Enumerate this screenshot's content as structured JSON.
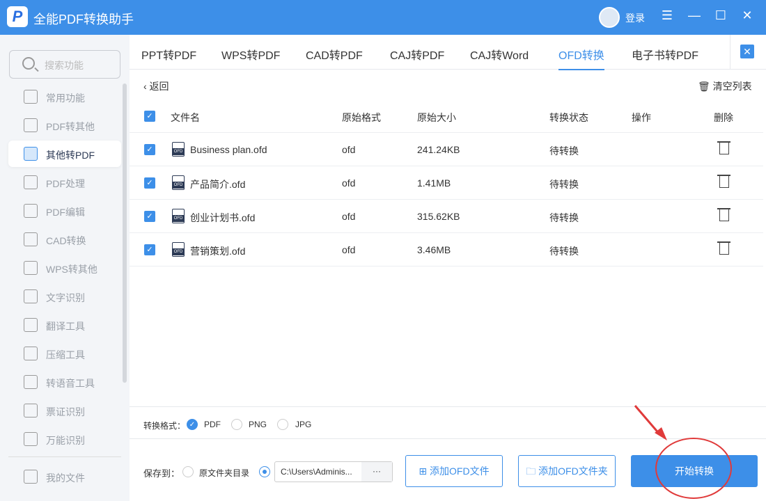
{
  "app": {
    "logo_letter": "P",
    "title": "全能PDF转换助手",
    "login": "登录",
    "menu": "☰",
    "minimize": "—",
    "maximize": "☐",
    "close": "✕"
  },
  "sidebar": {
    "search_placeholder": "搜索功能",
    "items": [
      {
        "label": "常用功能"
      },
      {
        "label": "PDF转其他"
      },
      {
        "label": "其他转PDF",
        "active": true
      },
      {
        "label": "PDF处理"
      },
      {
        "label": "PDF编辑"
      },
      {
        "label": "CAD转换"
      },
      {
        "label": "WPS转其他"
      },
      {
        "label": "文字识别"
      },
      {
        "label": "翻译工具"
      },
      {
        "label": "压缩工具"
      },
      {
        "label": "转语音工具"
      },
      {
        "label": "票证识别"
      },
      {
        "label": "万能识别"
      }
    ],
    "my_files": "我的文件"
  },
  "tabs": [
    {
      "label": "PPT转PDF"
    },
    {
      "label": "WPS转PDF"
    },
    {
      "label": "CAD转PDF"
    },
    {
      "label": "CAJ转PDF"
    },
    {
      "label": "CAJ转Word"
    },
    {
      "label": "OFD转换",
      "active": true
    },
    {
      "label": "电子书转PDF"
    }
  ],
  "tab_close": "✕",
  "toolbar": {
    "back": "‹  返回",
    "clear": "清空列表"
  },
  "table": {
    "columns": [
      "文件名",
      "原始格式",
      "原始大小",
      "转换状态",
      "操作",
      "删除"
    ],
    "rows": [
      {
        "name": "Business plan.ofd",
        "format": "ofd",
        "size": "241.24KB",
        "status": "待转换"
      },
      {
        "name": "产品简介.ofd",
        "format": "ofd",
        "size": "1.41MB",
        "status": "待转换"
      },
      {
        "name": "创业计划书.ofd",
        "format": "ofd",
        "size": "315.62KB",
        "status": "待转换"
      },
      {
        "name": "营销策划.ofd",
        "format": "ofd",
        "size": "3.46MB",
        "status": "待转换"
      }
    ]
  },
  "file_icon_label": "OFD",
  "format": {
    "label": "转换格式：",
    "options": [
      "PDF",
      "PNG",
      "JPG"
    ],
    "selected": "PDF"
  },
  "save": {
    "label": "保存到：",
    "original_dir": "原文件夹目录",
    "path": "C:\\Users\\Adminis...",
    "browse": "···",
    "selected": "custom"
  },
  "buttons": {
    "add_file": "添加OFD文件",
    "add_folder": "添加OFD文件夹",
    "start": "开始转换"
  },
  "colors": {
    "accent": "#3d8fe8",
    "annotation": "#e03a3a"
  }
}
